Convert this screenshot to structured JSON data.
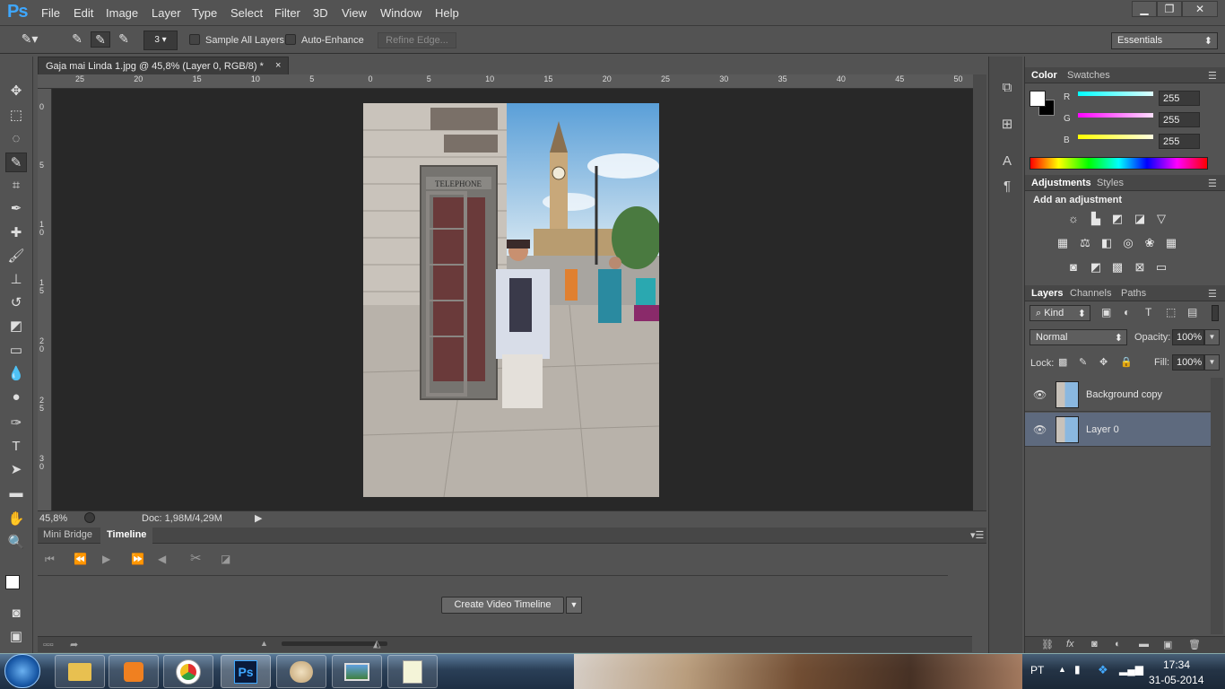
{
  "app": {
    "logo": "Ps"
  },
  "menubar": {
    "items": [
      "File",
      "Edit",
      "Image",
      "Layer",
      "Type",
      "Select",
      "Filter",
      "3D",
      "View",
      "Window",
      "Help"
    ]
  },
  "window_controls": {
    "minimize": "▁",
    "restore": "❐",
    "close": "✕"
  },
  "options": {
    "brush_size": "3",
    "sample_all_layers": "Sample All Layers",
    "auto_enhance": "Auto-Enhance",
    "refine_edge": "Refine Edge...",
    "workspace": "Essentials"
  },
  "document": {
    "tab_title": "Gaja mai Linda 1.jpg @ 45,8% (Layer 0, RGB/8) *",
    "close": "×",
    "ruler_top": [
      "25",
      "20",
      "15",
      "10",
      "5",
      "0",
      "5",
      "10",
      "15",
      "20",
      "25",
      "30",
      "35",
      "40",
      "45",
      "50"
    ],
    "ruler_left": [
      "0",
      "5",
      "1 0",
      "1 5",
      "2 0",
      "2 5",
      "3 0"
    ],
    "zoom": "45,8%",
    "doc_size": "Doc: 1,98M/4,29M"
  },
  "timeline": {
    "tabs": [
      "Mini Bridge",
      "Timeline"
    ],
    "create_button": "Create Video Timeline"
  },
  "color_panel": {
    "tabs": [
      "Color",
      "Swatches"
    ],
    "channels": [
      {
        "label": "R",
        "value": "255",
        "color": "#00e5ff"
      },
      {
        "label": "G",
        "value": "255",
        "color": "#ff2dff"
      },
      {
        "label": "B",
        "value": "255",
        "color": "#ffff00"
      }
    ]
  },
  "adjustments_panel": {
    "tabs": [
      "Adjustments",
      "Styles"
    ],
    "heading": "Add an adjustment"
  },
  "layers_panel": {
    "tabs": [
      "Layers",
      "Channels",
      "Paths"
    ],
    "kind": "Kind",
    "blend_mode": "Normal",
    "opacity_label": "Opacity:",
    "opacity": "100%",
    "lock_label": "Lock:",
    "fill_label": "Fill:",
    "fill": "100%",
    "layers": [
      {
        "name": "Background copy",
        "selected": false
      },
      {
        "name": "Layer 0",
        "selected": true
      }
    ]
  },
  "taskbar": {
    "language": "PT",
    "time": "17:34",
    "date": "31-05-2014"
  }
}
